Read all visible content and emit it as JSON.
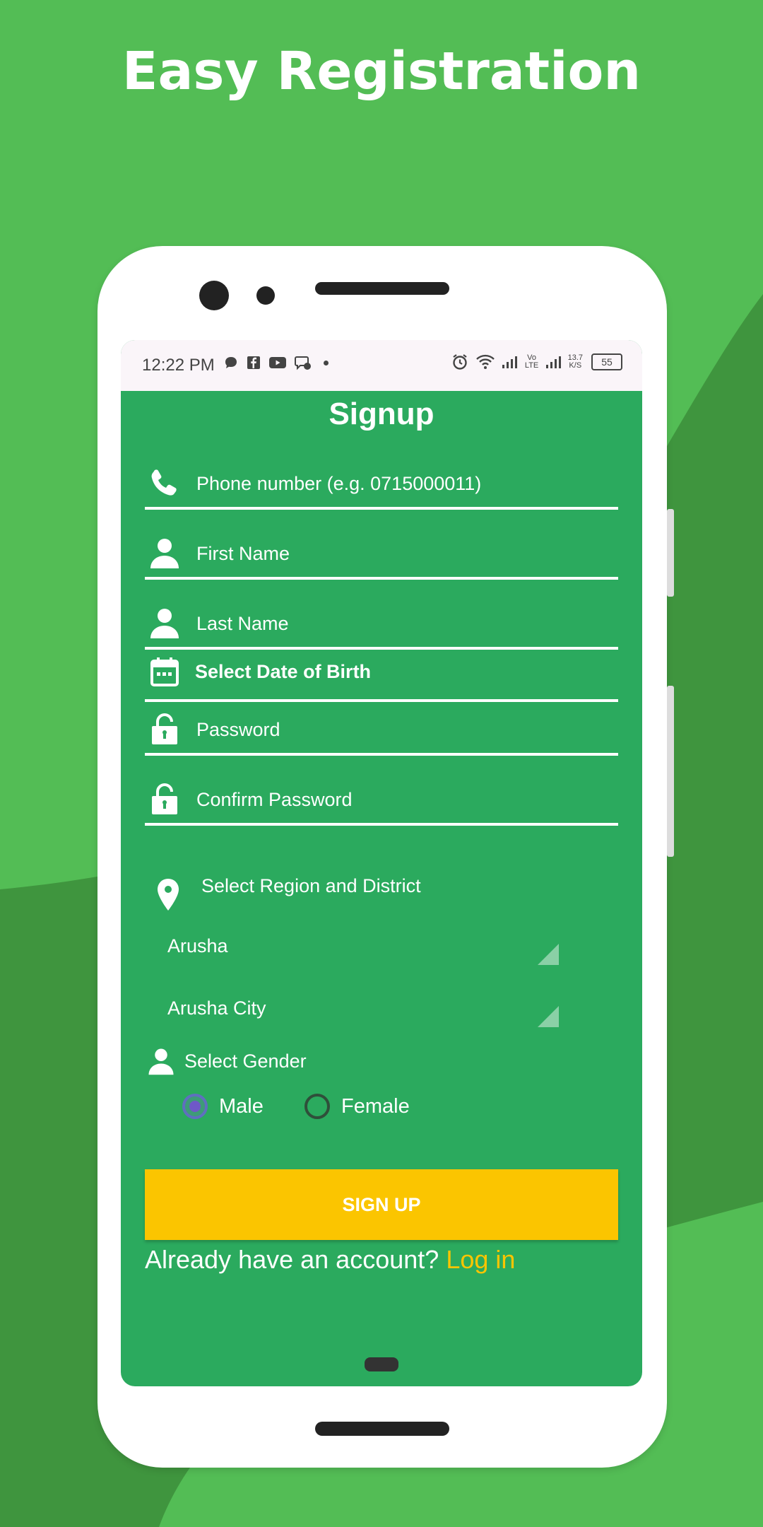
{
  "banner": {
    "title": "Easy Registration"
  },
  "status_bar": {
    "time": "12:22 PM",
    "network_label": "Vo LTE",
    "speed": "13.7",
    "speed_unit": "K/S",
    "battery": "55"
  },
  "form": {
    "title": "Signup",
    "phone_placeholder": "Phone number (e.g. 0715000011)",
    "first_name_placeholder": "First Name",
    "last_name_placeholder": "Last Name",
    "dob_label": "Select Date of Birth",
    "password_placeholder": "Password",
    "confirm_password_placeholder": "Confirm Password",
    "region_label": "Select Region and District",
    "region_value": "Arusha",
    "district_value": "Arusha City",
    "gender_label": "Select Gender",
    "gender_options": [
      "Male",
      "Female"
    ],
    "gender_selected": "Male",
    "signup_button": "SIGN UP",
    "login_prompt": "Already have an account?",
    "login_link": "Log in"
  },
  "colors": {
    "background": "#53BD55",
    "background_dark": "#3F953E",
    "screen": "#2BAA5E",
    "button": "#FBC500",
    "link": "#FBC500"
  }
}
